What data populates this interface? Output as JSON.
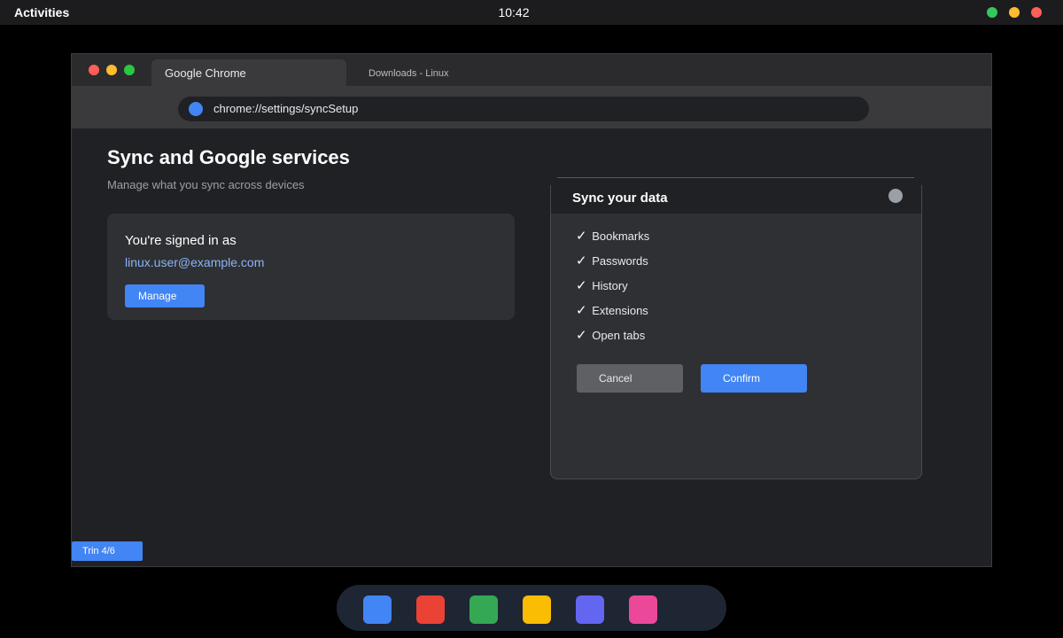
{
  "topbar": {
    "activities": "Activities",
    "clock": "10:42",
    "tray": [
      {
        "name": "network",
        "color": "#34c759"
      },
      {
        "name": "volume",
        "color": "#ffbd2e"
      },
      {
        "name": "power",
        "color": "#ff5f57"
      }
    ]
  },
  "window": {
    "traffic_lights": [
      "#ff5f57",
      "#ffbd2e",
      "#28c840"
    ],
    "tabs": [
      {
        "label": "Google Chrome",
        "active": true
      },
      {
        "label": "Downloads - Linux",
        "active": false
      }
    ],
    "omnibox": {
      "url": "chrome://settings/syncSetup",
      "icon": "site-info-icon",
      "icon_color": "#4285f4"
    }
  },
  "page": {
    "title": "Sync and Google services",
    "subtitle": "Manage what you sync across devices",
    "account": {
      "signed_in_label": "You're signed in as",
      "email": "linux.user@example.com",
      "manage_label": "Manage"
    }
  },
  "dialog": {
    "title": "Sync your data",
    "items": [
      {
        "check": "✓",
        "label": "Bookmarks"
      },
      {
        "check": "✓",
        "label": "Passwords"
      },
      {
        "check": "✓",
        "label": "History"
      },
      {
        "check": "✓",
        "label": "Extensions"
      },
      {
        "check": "✓",
        "label": "Open tabs"
      }
    ],
    "cancel_label": "Cancel",
    "confirm_label": "Confirm"
  },
  "step_badge": "Trin 4/6",
  "dock": {
    "apps": [
      {
        "name": "app-blue",
        "color": "#4285f4"
      },
      {
        "name": "app-red",
        "color": "#ea4335"
      },
      {
        "name": "app-green",
        "color": "#34a853"
      },
      {
        "name": "app-yellow",
        "color": "#fbbc04"
      },
      {
        "name": "app-indigo",
        "color": "#6366f1"
      },
      {
        "name": "app-pink",
        "color": "#ec4899"
      }
    ]
  },
  "colors": {
    "accent": "#4285f4",
    "link": "#8ab4f8",
    "background": "#202124"
  }
}
